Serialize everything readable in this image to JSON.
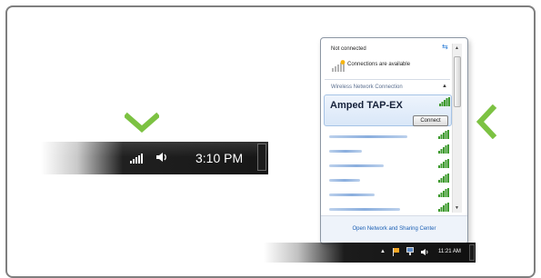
{
  "colors": {
    "accent_green": "#7cc242",
    "taskbar_dark": "#1c1c1c",
    "popup_link": "#1a5fb4",
    "signal_green": "#3e9a2e"
  },
  "left_taskbar": {
    "clock": "3:10 PM",
    "icons": [
      "signal-bars-icon",
      "speaker-icon"
    ]
  },
  "popup": {
    "status_title": "Not connected",
    "availability_text": "Connections are available",
    "group_label": "Wireless Network Connection",
    "selected_network": "Amped TAP-EX",
    "connect_button": "Connect",
    "footer_link": "Open Network and Sharing Center"
  },
  "right_taskbar": {
    "clock": "11:21 AM",
    "icons": [
      "tray-arrow-icon",
      "flag-icon",
      "network-icon",
      "speaker-icon"
    ]
  }
}
